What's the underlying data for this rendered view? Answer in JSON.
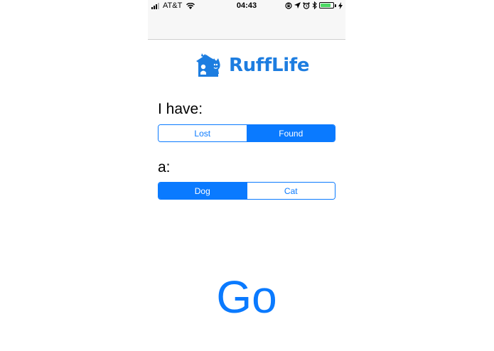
{
  "status_bar": {
    "carrier": "AT&T",
    "time": "04:43",
    "battery_fraction": 0.85,
    "icons": [
      "signal-icon",
      "wifi-icon",
      "rotation-lock-icon",
      "location-icon",
      "alarm-icon",
      "bluetooth-icon",
      "battery-icon",
      "charging-icon"
    ]
  },
  "logo": {
    "text": "RuffLife",
    "color": "#1d7de0"
  },
  "status_question": {
    "label": "I have:",
    "options": [
      "Lost",
      "Found"
    ],
    "selected": "Found"
  },
  "animal_question": {
    "label": "a:",
    "options": [
      "Dog",
      "Cat"
    ],
    "selected": "Dog"
  },
  "go_button": {
    "label": "Go"
  },
  "colors": {
    "accent": "#0a7aff",
    "battery": "#4cd964"
  }
}
